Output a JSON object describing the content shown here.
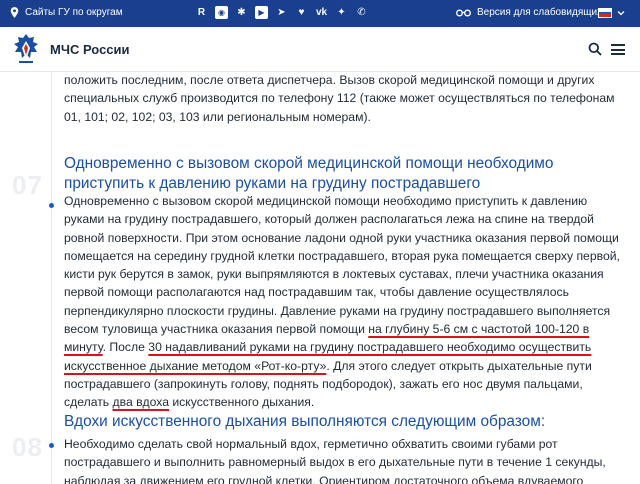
{
  "topbar": {
    "sites_label": "Сайты ГУ по округам",
    "social_icons": [
      "rutube-icon",
      "ok-icon",
      "dzen-icon",
      "youtube-icon",
      "telegram-icon",
      "heart-icon",
      "vk-icon",
      "tenchat-icon",
      "phone-icon"
    ],
    "social_glyphs": [
      "R",
      "◉",
      "✱",
      "▶",
      "➤",
      "♥",
      "vk",
      "✦",
      "✆"
    ],
    "accessibility_label": "Версия для слабовидящих",
    "colors": {
      "bar": "#1a3f8f",
      "accent": "#1a59c9",
      "heading": "#1a4ea7",
      "underline": "#d7141d"
    }
  },
  "header": {
    "brand": "МЧС России"
  },
  "article": {
    "intro": "положить последним, после ответа диспетчера. Вызов скорой медицинской помощи и других специальных служб производится по телефону 112 (также может осуществляться по телефонам 01, 101; 02, 102; 03, 103 или региональным номерам).",
    "section7": {
      "number": "07",
      "heading": "Одновременно с вызовом скорой медицинской помощи необходимо приступить к давлению руками на грудину пострадавшего",
      "text_before": "Одновременно с вызовом скорой медицинской помощи необходимо приступить к давлению руками на грудину пострадавшего, который должен располагаться лежа на спине на твердой ровной поверхности. При этом основание ладони одной руки участника оказания первой помощи помещается на середину грудной клетки пострадавшего, вторая рука помещается сверху первой, кисти рук берутся в замок, руки выпрямляются в локтевых суставах, плечи участника оказания первой помощи располагаются над пострадавшим так, чтобы давление осуществлялось перпендикулярно плоскости грудины. Давление руками на грудину пострадавшего выполняется весом туловища участника оказания первой помощи ",
      "highlight_1": "на глубину 5-6 см с частотой 100-120 в минуту",
      "text_mid": ". После ",
      "highlight_2": "30 надавливаний руками на грудину пострадавшего необходимо осуществить искусственное дыхание методом «Рот-ко-рту»",
      "text_after": ". Для этого следует открыть дыхательные пути пострадавшего (запрокинуть голову, поднять подбородок), зажать его нос двумя пальцами, сделать ",
      "highlight_3": "два вдоха",
      "text_end": " искусственного дыхания."
    },
    "section8": {
      "number": "08",
      "heading": "Вдохи искусственного дыхания выполняются следующим образом:",
      "text": "Необходимо сделать свой нормальный вдох, герметично обхватить своими губами рот пострадавшего и выполнить равномерный выдох в его дыхательные пути в течение 1 секунды, наблюдая за движением его грудной клетки. Ориентиром достаточного объема вдуваемого воздуха и"
    }
  }
}
